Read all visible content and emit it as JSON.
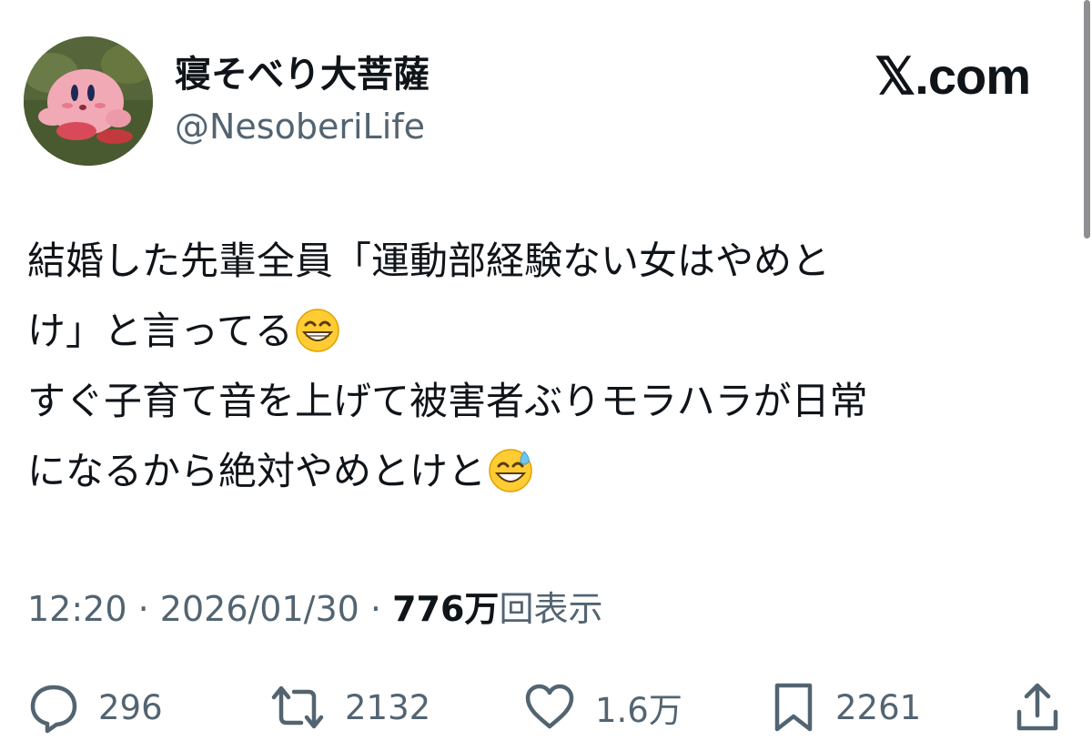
{
  "author": {
    "display_name": "寝そべり大菩薩",
    "handle": "@NesoberiLife"
  },
  "brand": "𝕏.com",
  "tweet": {
    "lines": [
      "結婚した先輩全員「運動部経験ない女はやめと",
      "け」と言ってる",
      "すぐ子育て音を上げて被害者ぶりモラハラが日常",
      "になるから絶対やめとけと"
    ],
    "emojis": [
      "grinning-face-with-smiling-eyes",
      "grinning-face-with-sweat"
    ]
  },
  "meta": {
    "time": "12:20",
    "separator": "·",
    "date": "2026/01/30",
    "views_count": "776万",
    "views_label": "回表示"
  },
  "actions": {
    "replies": "296",
    "retweets": "2132",
    "likes": "1.6万",
    "bookmarks": "2261"
  },
  "colors": {
    "text": "#0f1419",
    "secondary": "#536471",
    "background": "#ffffff"
  }
}
